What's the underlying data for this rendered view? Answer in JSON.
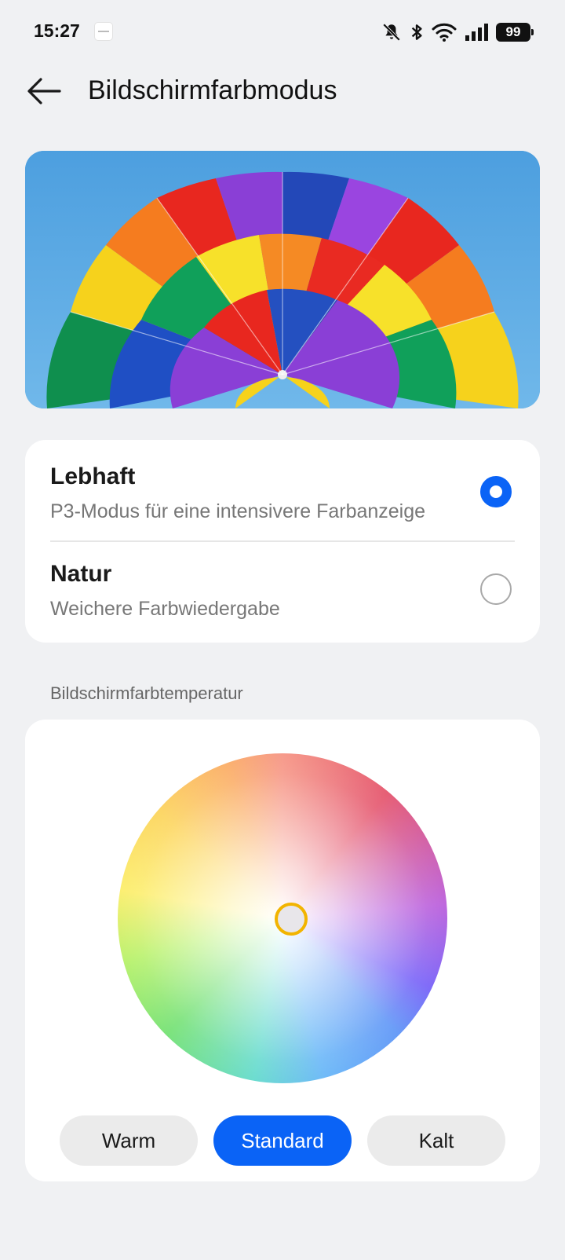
{
  "status_bar": {
    "time": "15:27",
    "icons": [
      "app-notification-icon",
      "bell-muted-icon",
      "bluetooth-icon",
      "wifi-icon",
      "signal-icon",
      "battery-icon"
    ],
    "battery_level": "99"
  },
  "header": {
    "back_icon": "arrow-left-icon",
    "title": "Bildschirmfarbmodus"
  },
  "hero": {
    "image_subject": "rainbow parachute canopy against blue sky"
  },
  "color_modes": {
    "options": [
      {
        "title": "Lebhaft",
        "description": "P3-Modus für eine intensivere Farbanzeige",
        "selected": true
      },
      {
        "title": "Natur",
        "description": "Weichere Farbwiedergabe",
        "selected": false
      }
    ]
  },
  "temperature": {
    "section_label": "Bildschirmfarbtemperatur",
    "buttons": [
      {
        "label": "Warm",
        "active": false
      },
      {
        "label": "Standard",
        "active": true
      },
      {
        "label": "Kalt",
        "active": false
      }
    ]
  },
  "colors": {
    "accent": "#0a63f6",
    "background": "#f0f1f3",
    "card": "#ffffff",
    "handle_ring": "#f2b400"
  }
}
